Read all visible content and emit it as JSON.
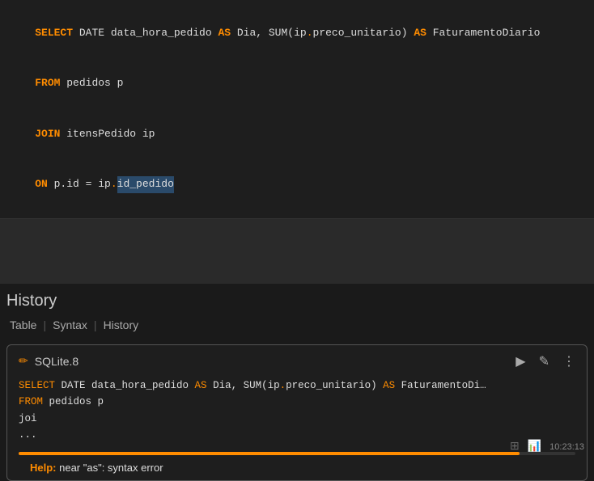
{
  "editor": {
    "lines": [
      {
        "id": "line1",
        "parts": [
          {
            "text": "SELECT",
            "class": "kw-select"
          },
          {
            "text": " DATE data_hora_pedido ",
            "class": "text-normal"
          },
          {
            "text": "AS",
            "class": "kw-as"
          },
          {
            "text": " Dia, SUM(ip",
            "class": "text-normal"
          },
          {
            "text": ".",
            "class": "text-dot"
          },
          {
            "text": "preco_unitario) ",
            "class": "text-normal"
          },
          {
            "text": "AS",
            "class": "kw-as"
          },
          {
            "text": " FaturamentoDiario",
            "class": "text-normal"
          }
        ]
      },
      {
        "id": "line2",
        "parts": [
          {
            "text": "FROM",
            "class": "kw-from"
          },
          {
            "text": " pedidos p",
            "class": "text-normal"
          }
        ]
      },
      {
        "id": "line3",
        "parts": [
          {
            "text": "JOIN",
            "class": "kw-join"
          },
          {
            "text": " itensPedido ip",
            "class": "text-normal"
          }
        ]
      },
      {
        "id": "line4",
        "parts": [
          {
            "text": "ON",
            "class": "kw-on"
          },
          {
            "text": " p.id = ip",
            "class": "text-normal"
          },
          {
            "text": ".",
            "class": "text-dot"
          },
          {
            "text": "id_pedido",
            "class": "text-normal",
            "highlight": true
          }
        ]
      }
    ]
  },
  "history": {
    "title": "History",
    "tabs": [
      {
        "label": "Table",
        "id": "tab-table"
      },
      {
        "label": "Syntax",
        "id": "tab-syntax"
      },
      {
        "label": "History",
        "id": "tab-history"
      }
    ],
    "separator": "|"
  },
  "card": {
    "db_icon": "✏",
    "db_name": "SQLite.8",
    "actions": {
      "play": "▶",
      "edit": "✎",
      "more": "⋮"
    },
    "code_lines": [
      {
        "parts": [
          {
            "text": "SELECT",
            "class": "kw"
          },
          {
            "text": " DATE data_hora_pedido ",
            "class": ""
          },
          {
            "text": "AS",
            "class": "kw"
          },
          {
            "text": " Dia, SUM(ip",
            "class": ""
          },
          {
            "text": ".",
            "class": "dot"
          },
          {
            "text": "preco_unitario) ",
            "class": ""
          },
          {
            "text": "AS",
            "class": "kw"
          },
          {
            "text": " FaturamentoDi…",
            "class": ""
          }
        ]
      },
      {
        "parts": [
          {
            "text": "FROM",
            "class": "kw"
          },
          {
            "text": " pedidos p",
            "class": ""
          }
        ]
      },
      {
        "parts": [
          {
            "text": "joi",
            "class": ""
          }
        ]
      },
      {
        "parts": [
          {
            "text": "...",
            "class": ""
          }
        ]
      }
    ],
    "progress": 90,
    "help_label": "Help:",
    "help_text": " near \"as\": syntax error"
  },
  "statusbar": {
    "time": "10:23:13",
    "icons": [
      "⊞",
      "📊"
    ]
  }
}
